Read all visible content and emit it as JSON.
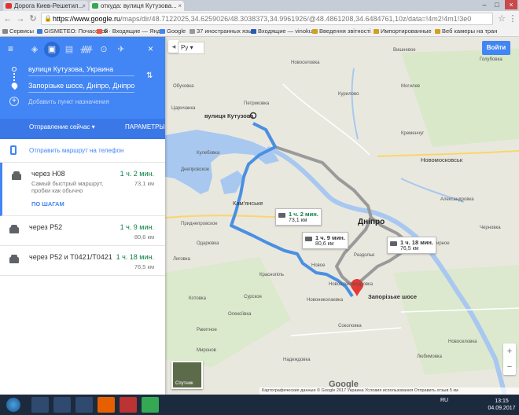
{
  "browser": {
    "tabs": [
      {
        "title": "Дорога Киев-Решетил...",
        "active": false
      },
      {
        "title": "откуда: вулиця Кутузова...",
        "active": true
      }
    ],
    "address_host": "https://www.google.ru",
    "address_path": "/maps/dir/48.7122025,34.6259026/48.3038373,34.9961926/@48.4861208,34.6484761,10z/data=!4m2!4m1!3e0",
    "bookmarks": [
      "Сервисы",
      "GISMETEO: Почасовой",
      "6 · Входящие — Янд",
      "Google",
      "37 иностранных язы",
      "Входящие — vinokur",
      "Введення звітності",
      "Импортированные",
      "Веб камеры на тран"
    ]
  },
  "panel": {
    "origin": "вулиця Кутузова, Украина",
    "destination": "Запорізьке шосе, Дніпро, Дніпропетр",
    "add_destination": "Добавить пункт назначения",
    "depart_label": "Отправление сейчас",
    "params_label": "ПАРАМЕТРЫ",
    "send_to_phone": "Отправить маршрут на телефон",
    "routes": [
      {
        "name": "через Н08",
        "time": "1 ч. 2 мин.",
        "distance": "73,1 км",
        "desc": "Самый быстрый маршрут, пробки как обычно",
        "steps": "ПО ШАГАМ",
        "selected": true
      },
      {
        "name": "через Р52",
        "time": "1 ч. 9 мин.",
        "distance": "80,6 км",
        "selected": false
      },
      {
        "name": "через Р52 и Т0421/Т0421",
        "time": "1 ч. 18 мин.",
        "distance": "76,5 км",
        "selected": false
      }
    ]
  },
  "map": {
    "lang": "Ру",
    "login_button": "Войти",
    "origin_label": "вулиця Кутузова",
    "destination_label": "Запорізьке шосе",
    "city_label": "Дніпро",
    "city2_label": "Новомосковськ",
    "callouts": [
      {
        "time": "1 ч. 2 мин.",
        "distance": "73,1 км",
        "selected": true
      },
      {
        "time": "1 ч. 9 мин.",
        "distance": "80,6 км",
        "selected": false
      },
      {
        "time": "1 ч. 18 мин.",
        "distance": "76,5 км",
        "selected": false
      }
    ],
    "places": [
      "Кам'янське",
      "Петриковка",
      "Голубовка",
      "Царичанка",
      "Кулебовка",
      "Новое",
      "Приднепровское",
      "Днепровское",
      "Вишневое",
      "Могилев",
      "Курилово",
      "Кременчуг",
      "Одарювка",
      "Лиговка",
      "Обуховка",
      "Новоселовка",
      "Краснопіль",
      "Олексіївка",
      "Мирное",
      "Котовка",
      "Раздолье",
      "Александровка",
      "Черновка",
      "Новоалександровка",
      "Сурское",
      "Новониколаевка",
      "Соколовка",
      "Ракитное",
      "Миронов",
      "Надеждовка",
      "Любимовка",
      "Новоселовка"
    ],
    "satellite_label": "Спутник",
    "attribution": "Картографические данные © Google 2017   Украина   Условия использования   Отправить отзыв   5 км",
    "google_logo": "Google"
  },
  "taskbar": {
    "lang": "RU",
    "time": "13:15",
    "date": "04.09.2017"
  },
  "colors": {
    "accent": "#4285f4",
    "route_selected": "#4a90e2",
    "route_alt": "#9a9a9a",
    "time_green": "#0b8043"
  }
}
